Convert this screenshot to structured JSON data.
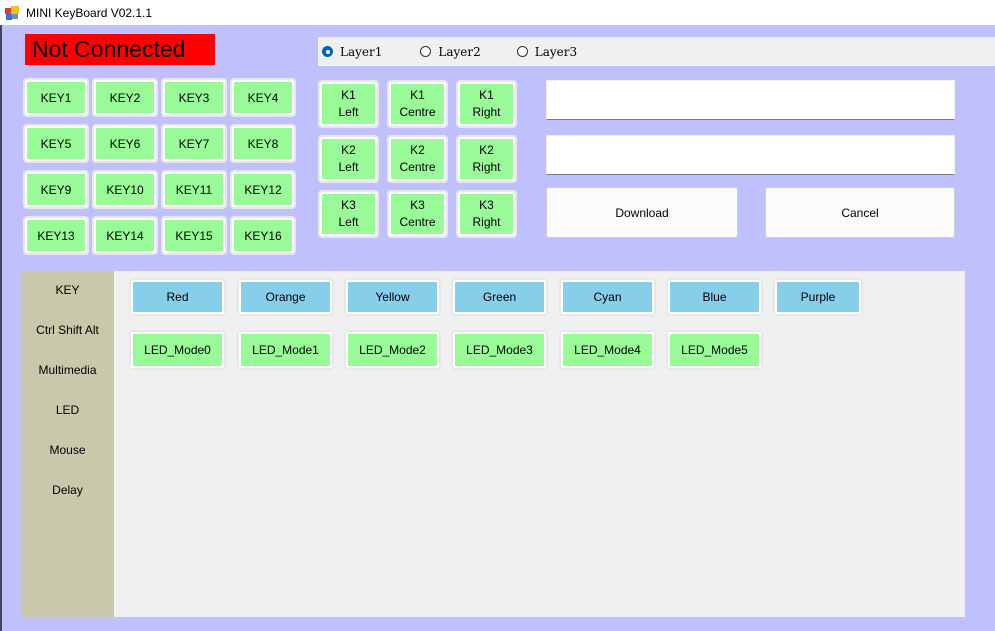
{
  "window": {
    "title": "MINI KeyBoard V02.1.1",
    "icon": "app-window-icon"
  },
  "status": {
    "text": "Not Connected",
    "color": "#ff0000"
  },
  "layers": {
    "options": [
      "Layer1",
      "Layer2",
      "Layer3"
    ],
    "selected": "Layer1"
  },
  "keys": [
    "KEY1",
    "KEY2",
    "KEY3",
    "KEY4",
    "KEY5",
    "KEY6",
    "KEY7",
    "KEY8",
    "KEY9",
    "KEY10",
    "KEY11",
    "KEY12",
    "KEY13",
    "KEY14",
    "KEY15",
    "KEY16"
  ],
  "knobs": [
    {
      "line1": "K1",
      "line2": "Left"
    },
    {
      "line1": "K1",
      "line2": "Centre"
    },
    {
      "line1": "K1",
      "line2": "Right"
    },
    {
      "line1": "K2",
      "line2": "Left"
    },
    {
      "line1": "K2",
      "line2": "Centre"
    },
    {
      "line1": "K2",
      "line2": "Right"
    },
    {
      "line1": "K3",
      "line2": "Left"
    },
    {
      "line1": "K3",
      "line2": "Centre"
    },
    {
      "line1": "K3",
      "line2": "Right"
    }
  ],
  "inputs": {
    "field1_value": "",
    "field2_value": ""
  },
  "actions": {
    "download": "Download",
    "cancel": "Cancel"
  },
  "sidenav": [
    "KEY",
    "Ctrl Shift Alt",
    "Multimedia",
    "LED",
    "Mouse",
    "Delay"
  ],
  "colors": [
    "Red",
    "Orange",
    "Yellow",
    "Green",
    "Cyan",
    "Blue",
    "Purple"
  ],
  "led_modes": [
    "LED_Mode0",
    "LED_Mode1",
    "LED_Mode2",
    "LED_Mode3",
    "LED_Mode4",
    "LED_Mode5"
  ],
  "theme": {
    "background": "#c0c0ff",
    "key_button": "#98fb98",
    "color_button": "#87ceeb",
    "sidenav": "#c8c8aa",
    "panel": "#f0f0f0"
  }
}
